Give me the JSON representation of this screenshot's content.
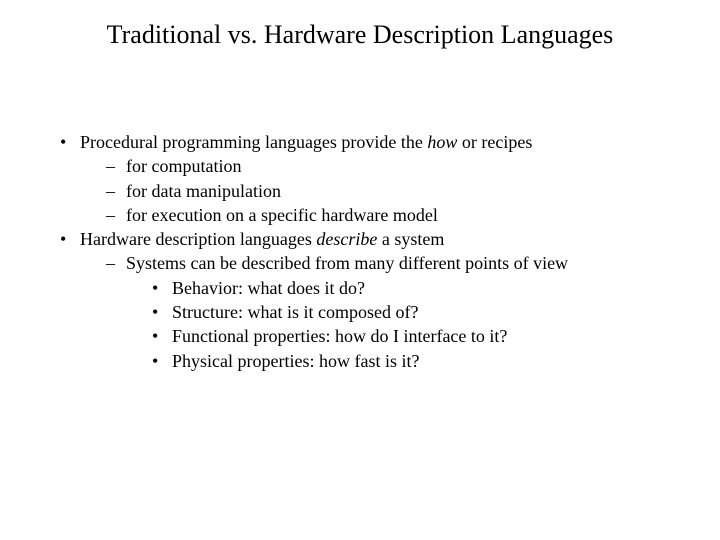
{
  "title": "Traditional vs. Hardware Description Languages",
  "bullets": {
    "b1_pre": "Procedural programming languages provide the ",
    "b1_em": "how",
    "b1_post": " or recipes",
    "b1_sub1": "for computation",
    "b1_sub2": "for data manipulation",
    "b1_sub3": "for execution on a specific hardware model",
    "b2_pre": "Hardware description languages ",
    "b2_em": "describe",
    "b2_post": " a system",
    "b2_sub1": "Systems can be described from many different points of view",
    "b2_sub1_a": "Behavior: what does it do?",
    "b2_sub1_b": "Structure: what is it composed of?",
    "b2_sub1_c": "Functional properties: how do I interface to it?",
    "b2_sub1_d": "Physical properties: how fast is it?"
  }
}
